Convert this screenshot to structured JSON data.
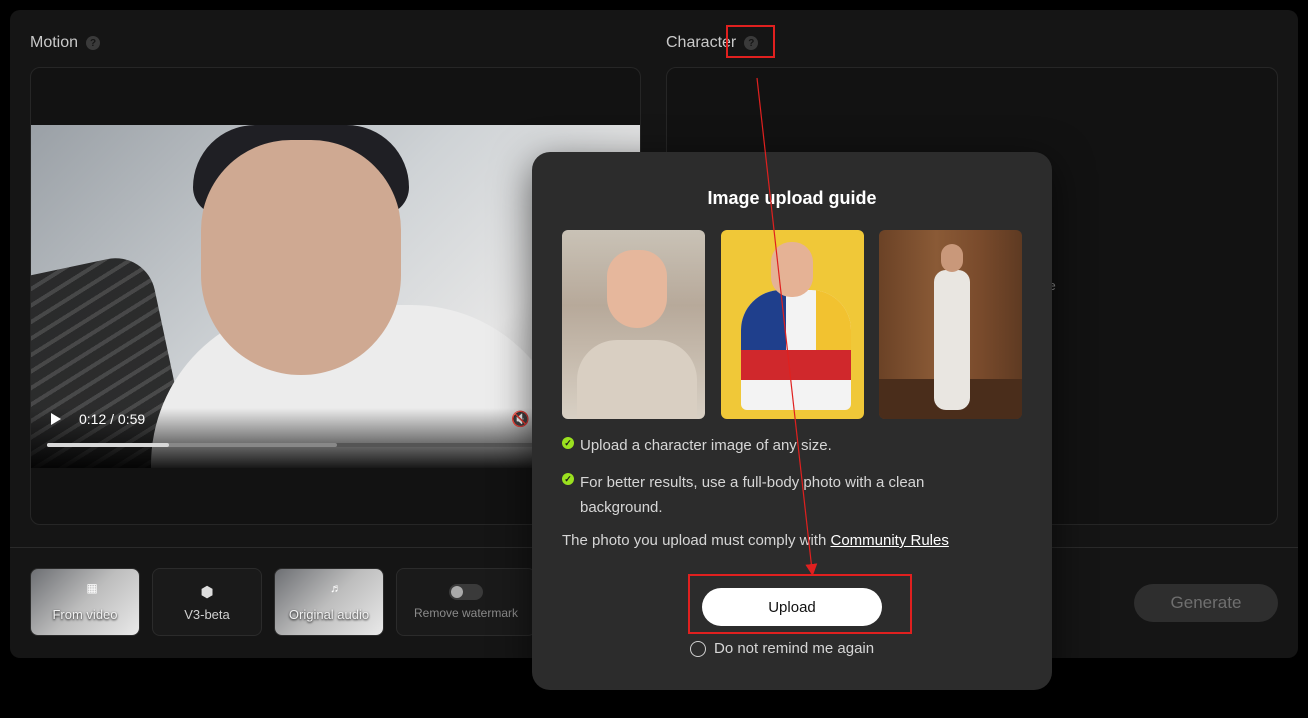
{
  "motion": {
    "title": "Motion",
    "help_icon": "question-circle-icon",
    "video": {
      "time": "0:12 / 0:59",
      "played_fraction": 0.21,
      "buffered_fraction": 0.5
    }
  },
  "character": {
    "title": "Character",
    "help_icon": "question-circle-icon",
    "partial_text": "ere"
  },
  "toolbar": {
    "from_video": "From video",
    "model": "V3-beta",
    "original_audio": "Original audio",
    "remove_watermark": "Remove watermark",
    "generate": "Generate"
  },
  "modal": {
    "title": "Image upload guide",
    "tips": [
      "Upload a character image of any size.",
      "For better results, use a full-body photo with a clean background."
    ],
    "comply_text": "The photo you upload must comply with",
    "comply_link": "Community Rules",
    "upload_label": "Upload",
    "remind_label": "Do not remind me again"
  },
  "colors": {
    "annotation_red": "#e0201f",
    "check_green": "#9be11f"
  }
}
